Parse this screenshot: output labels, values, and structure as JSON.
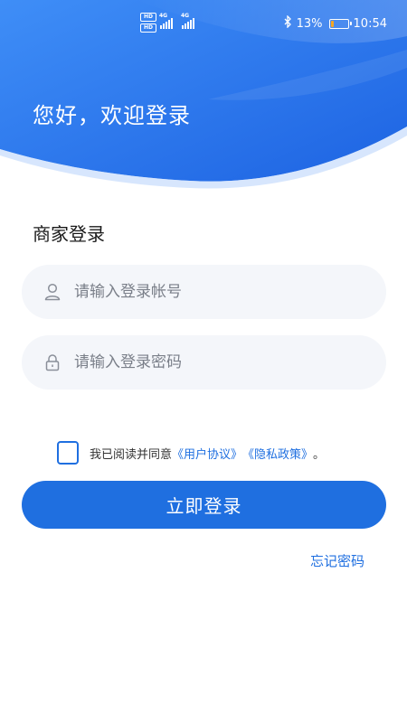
{
  "status_bar": {
    "hd_top": "HD",
    "hd_bottom": "HD",
    "sig1_label": "4G",
    "sig2_label": "4G",
    "battery_percent": "13%",
    "battery_level": 0.13,
    "time": "10:54",
    "icons": [
      "hd-icon",
      "signal-icon",
      "bluetooth-icon",
      "battery-icon"
    ]
  },
  "header": {
    "greeting": "您好，欢迎登录",
    "gradient_start": "#3f8ef7",
    "gradient_end": "#1d63e2"
  },
  "form": {
    "title": "商家登录",
    "account": {
      "value": "",
      "placeholder": "请输入登录帐号",
      "icon": "user-icon"
    },
    "password": {
      "value": "",
      "placeholder": "请输入登录密码",
      "icon": "lock-icon"
    },
    "agreement": {
      "checked": false,
      "prefix": "我已阅读并同意",
      "user_agreement": "《用户协议》",
      "privacy_policy": "《隐私政策》",
      "suffix": "。"
    },
    "login_label": "立即登录",
    "forgot_label": "忘记密码"
  },
  "colors": {
    "accent": "#1f6fe0",
    "input_bg": "#f4f6fa",
    "placeholder": "#7a7f89"
  }
}
